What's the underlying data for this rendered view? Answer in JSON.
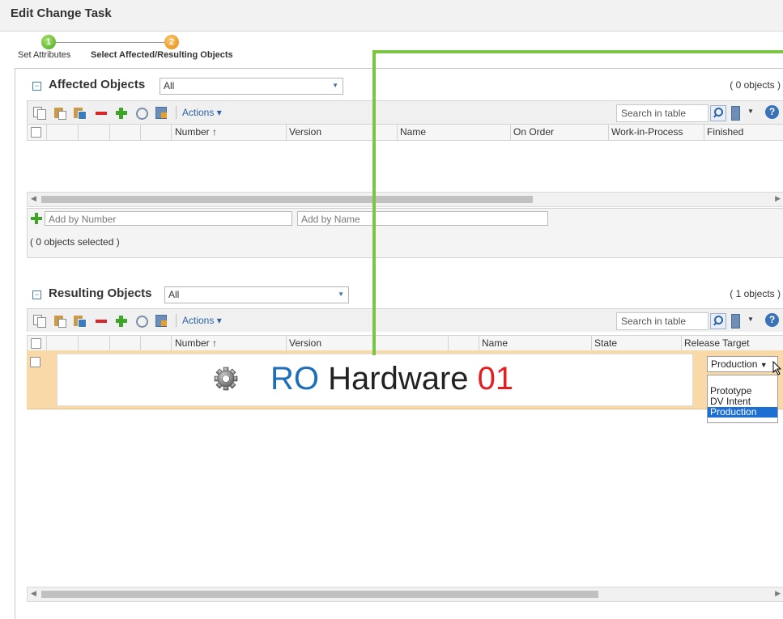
{
  "window": {
    "title": "Edit Change Task"
  },
  "wizard": {
    "steps": [
      {
        "number": "1",
        "label": "Set Attributes",
        "active": false
      },
      {
        "number": "2",
        "label": "Select Affected/Resulting Objects",
        "active": true
      }
    ]
  },
  "affected": {
    "title": "Affected Objects",
    "view": "All",
    "count": "( 0 objects )",
    "actions_label": "Actions",
    "search_placeholder": "Search in table",
    "columns": [
      "Number",
      "Version",
      "Name",
      "On Order",
      "Work-in-Process",
      "Finished"
    ],
    "sort_indicator": "↑",
    "add_by_number_placeholder": "Add by Number",
    "add_by_name_placeholder": "Add by Name",
    "selected_count": "( 0 objects selected )"
  },
  "resulting": {
    "title": "Resulting Objects",
    "view": "All",
    "count": "( 1 objects )",
    "actions_label": "Actions",
    "search_placeholder": "Search in table",
    "columns": [
      "Number",
      "Version",
      "Name",
      "State",
      "Release Target"
    ],
    "sort_indicator": "↑",
    "row": {
      "title_part1": "RO",
      "title_part2": " Hardware ",
      "title_part3": "01",
      "release_target": "Production",
      "release_options": [
        "Prototype",
        "DV Intent",
        "Production"
      ],
      "selected_option": "Production"
    }
  },
  "colors": {
    "accent_blue": "#1e6fba",
    "highlight_green": "#7cc443",
    "row_highlight": "#f8d9a7",
    "title_red": "#e41e1e"
  }
}
